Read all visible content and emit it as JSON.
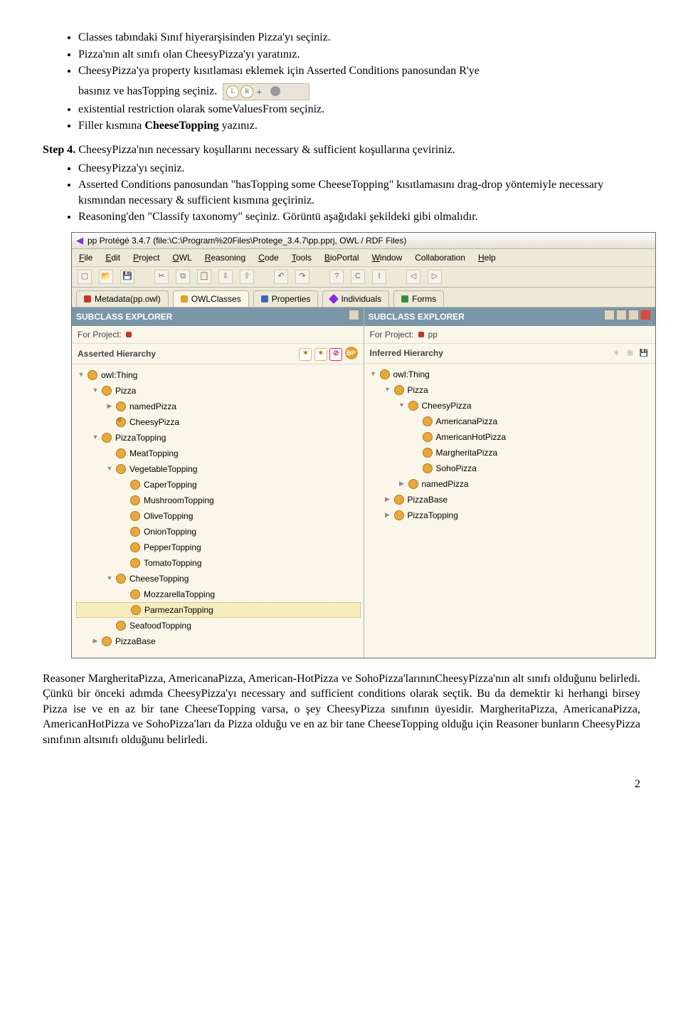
{
  "bullets1": [
    "Classes tabındaki Sınıf hiyerarşisinden Pizza'yı seçiniz.",
    " Pizza'nın alt sınıfı olan CheesyPizza'yı yaratınız.",
    "CheesyPizza'ya property kısıtlaması eklemek için Asserted Conditions panosundan R'ye"
  ],
  "bullet1_cont_a": "basınız ve hasTopping seçiniz.",
  "bullet1_cont_b": " existential restriction olarak someValuesFrom seçiniz.",
  "bullet1_c": "Filler kısmına CheeseTopping yazınız.",
  "step4_label": "Step 4.",
  "step4_text": " CheesyPizza'nın necessary koşullarını necessary & sufficient koşullarına çeviriniz.",
  "bullets2": [
    "CheesyPizza'yı seçiniz.",
    "Asserted Conditions panosundan \"hasTopping some CheeseTopping\" kısıtlamasını drag-drop yöntemiyle necessary kısmından necessary & sufficient kısmına geçiriniz.",
    "Reasoning'den \"Classify taxonomy\" seçiniz. Görüntü aşağıdaki şekildeki gibi olmalıdır."
  ],
  "app": {
    "title": "pp Protégé 3.4.7    (file:\\C:\\Program%20Files\\Protege_3.4.7\\pp.pprj, OWL / RDF Files)",
    "menu": [
      "File",
      "Edit",
      "Project",
      "OWL",
      "Reasoning",
      "Code",
      "Tools",
      "BioPortal",
      "Window",
      "Collaboration",
      "Help"
    ],
    "tabs": [
      {
        "label": "Metadata(pp.owl)",
        "dot": "d-red"
      },
      {
        "label": "OWLClasses",
        "dot": "d-yel",
        "active": true
      },
      {
        "label": "Properties",
        "dot": "d-blu"
      },
      {
        "label": "Individuals",
        "dot": "d-pur"
      },
      {
        "label": "Forms",
        "dot": "d-grn"
      }
    ],
    "left": {
      "header": "SUBCLASS EXPLORER",
      "project_label": "For Project:",
      "hier_label": "Asserted Hierarchy",
      "tree": [
        {
          "indent": 0,
          "tw": "v",
          "label": "owl:Thing"
        },
        {
          "indent": 1,
          "tw": "v",
          "label": "Pizza"
        },
        {
          "indent": 2,
          "tw": "r",
          "label": "namedPizza"
        },
        {
          "indent": 2,
          "tw": "",
          "def": true,
          "label": "CheesyPizza"
        },
        {
          "indent": 1,
          "tw": "v",
          "label": "PizzaTopping"
        },
        {
          "indent": 2,
          "tw": "",
          "label": "MeatTopping"
        },
        {
          "indent": 2,
          "tw": "v",
          "label": "VegetableTopping"
        },
        {
          "indent": 3,
          "tw": "",
          "label": "CaperTopping"
        },
        {
          "indent": 3,
          "tw": "",
          "label": "MushroomTopping"
        },
        {
          "indent": 3,
          "tw": "",
          "label": "OliveTopping"
        },
        {
          "indent": 3,
          "tw": "",
          "label": "OnionTopping"
        },
        {
          "indent": 3,
          "tw": "",
          "label": "PepperTopping"
        },
        {
          "indent": 3,
          "tw": "",
          "label": "TomatoTopping"
        },
        {
          "indent": 2,
          "tw": "v",
          "label": "CheeseTopping"
        },
        {
          "indent": 3,
          "tw": "",
          "label": "MozzarellaTopping"
        },
        {
          "indent": 3,
          "tw": "",
          "sel": true,
          "label": "ParmezanTopping"
        },
        {
          "indent": 2,
          "tw": "",
          "label": "SeafoodTopping"
        },
        {
          "indent": 1,
          "tw": "r",
          "label": "PizzaBase"
        }
      ]
    },
    "right": {
      "header": "SUBCLASS EXPLORER",
      "project_label": "For Project:",
      "project_name": "pp",
      "hier_label": "Inferred Hierarchy",
      "tree": [
        {
          "indent": 0,
          "tw": "v",
          "label": "owl:Thing"
        },
        {
          "indent": 1,
          "tw": "v",
          "label": "Pizza"
        },
        {
          "indent": 2,
          "tw": "v",
          "label": "CheesyPizza"
        },
        {
          "indent": 3,
          "tw": "",
          "label": "AmericanaPizza"
        },
        {
          "indent": 3,
          "tw": "",
          "label": "AmericanHotPizza"
        },
        {
          "indent": 3,
          "tw": "",
          "label": "MargheritaPizza"
        },
        {
          "indent": 3,
          "tw": "",
          "label": "SohoPizza"
        },
        {
          "indent": 2,
          "tw": "r",
          "label": "namedPizza"
        },
        {
          "indent": 1,
          "tw": "r",
          "label": "PizzaBase"
        },
        {
          "indent": 1,
          "tw": "r",
          "label": "PizzaTopping"
        }
      ]
    }
  },
  "para": "Reasoner MargheritaPizza, AmericanaPizza, American-HotPizza ve SohoPizza'larınınCheesyPizza'nın alt sınıfı olduğunu belirledi. Çünkü bir önceki adımda CheesyPizza'yı necessary and sufficient conditions olarak seçtik. Bu da demektir ki herhangi birsey Pizza ise ve en az bir tane CheeseTopping varsa, o şey CheesyPizza sınıfının üyesidir. MargheritaPizza, AmericanaPizza, AmericanHotPizza ve SohoPizza'ları da Pizza olduğu ve  en az bir tane CheeseTopping olduğu için Reasoner bunların CheesyPizza sınıfının altsınıfı olduğunu belirledi.",
  "pagenum": "2"
}
